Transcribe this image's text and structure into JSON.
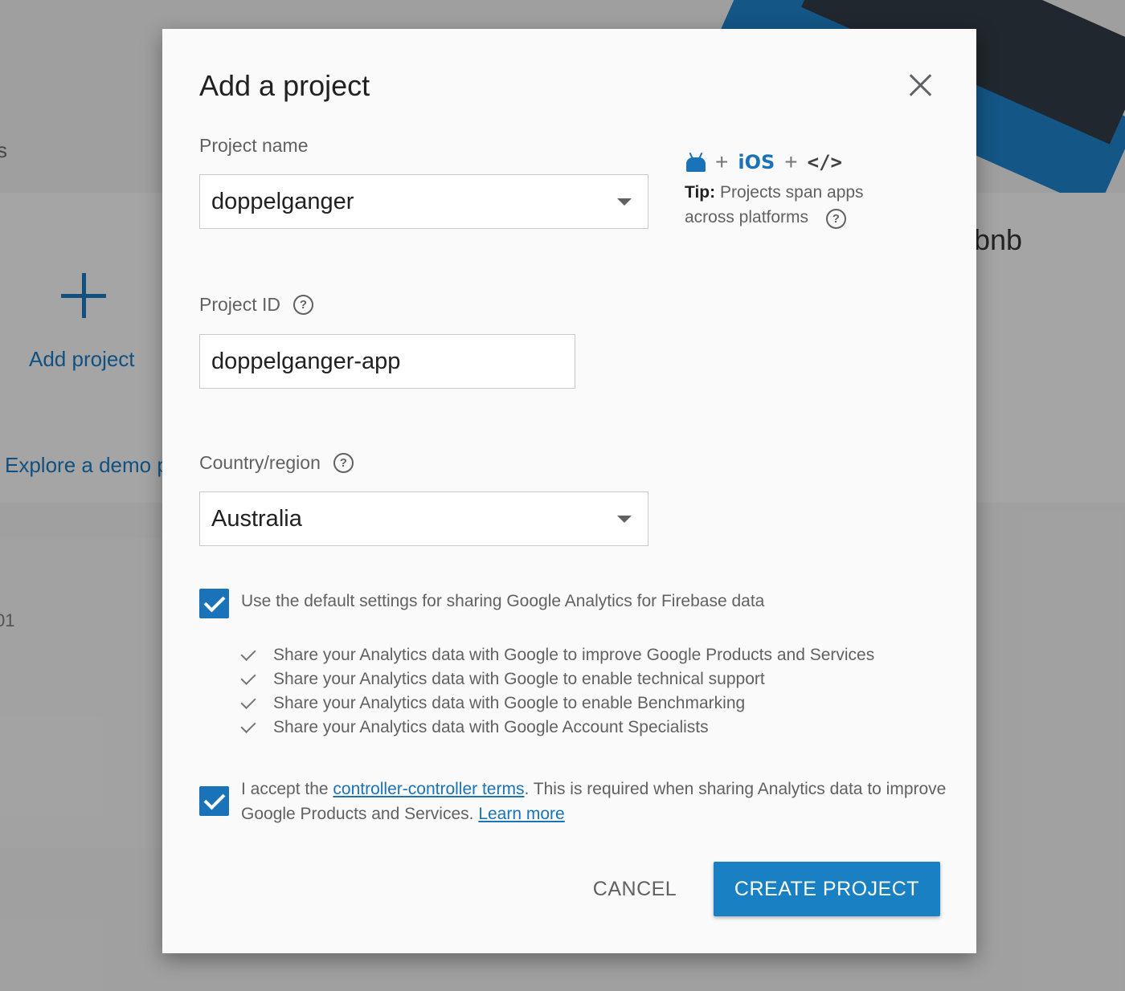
{
  "background": {
    "side_text": "s",
    "add_project_label": "Add project",
    "explore_label": "Explore a demo p",
    "project_card_fragment": "bnb",
    "row_fragment": "01"
  },
  "dialog": {
    "title": "Add a project",
    "project_name": {
      "label": "Project name",
      "value": "doppelganger"
    },
    "tip": {
      "plus": "+",
      "ios": "iOS",
      "code": "</>",
      "bold": "Tip:",
      "text": "Projects span apps across platforms"
    },
    "project_id": {
      "label": "Project ID",
      "value": "doppelganger-app"
    },
    "country": {
      "label": "Country/region",
      "value": "Australia"
    },
    "help_glyph": "?",
    "analytics_checkbox_label": "Use the default settings for sharing Google Analytics for Firebase data",
    "analytics_items": [
      "Share your Analytics data with Google to improve Google Products and Services",
      "Share your Analytics data with Google to enable technical support",
      "Share your Analytics data with Google to enable Benchmarking",
      "Share your Analytics data with Google Account Specialists"
    ],
    "terms": {
      "prefix": "I accept the ",
      "link": "controller-controller terms",
      "middle": ". This is required when sharing Analytics data to improve Google Products and Services. ",
      "learn_more": "Learn more"
    },
    "cancel_label": "CANCEL",
    "create_label": "CREATE PROJECT"
  },
  "colors": {
    "accent": "#1a73b8",
    "primary_button": "#1a80c4"
  }
}
